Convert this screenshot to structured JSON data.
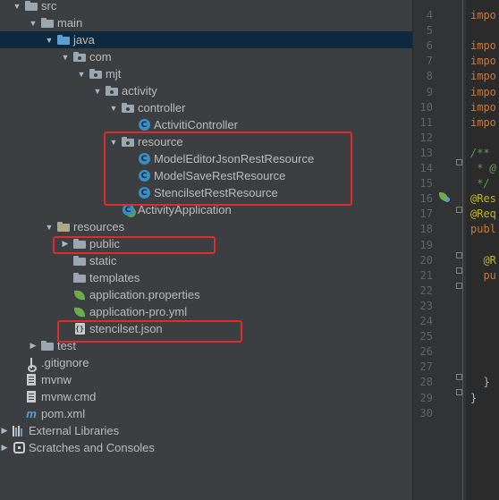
{
  "project_tree": {
    "items": [
      {
        "label": "src",
        "indent": 1,
        "arrow": "down",
        "icon": "folder-icon"
      },
      {
        "label": "main",
        "indent": 2,
        "arrow": "down",
        "icon": "folder-icon"
      },
      {
        "label": "java",
        "indent": 3,
        "arrow": "down",
        "icon": "source-folder-icon",
        "selected": true
      },
      {
        "label": "com",
        "indent": 4,
        "arrow": "down",
        "icon": "package-icon"
      },
      {
        "label": "mjt",
        "indent": 5,
        "arrow": "down",
        "icon": "package-icon"
      },
      {
        "label": "activity",
        "indent": 6,
        "arrow": "down",
        "icon": "package-icon"
      },
      {
        "label": "controller",
        "indent": 7,
        "arrow": "down",
        "icon": "package-icon"
      },
      {
        "label": "ActivitiController",
        "indent": 8,
        "arrow": "none",
        "icon": "class-icon"
      },
      {
        "label": "resource",
        "indent": 7,
        "arrow": "down",
        "icon": "package-icon"
      },
      {
        "label": "ModelEditorJsonRestResource",
        "indent": 8,
        "arrow": "none",
        "icon": "class-icon"
      },
      {
        "label": "ModelSaveRestResource",
        "indent": 8,
        "arrow": "none",
        "icon": "class-icon"
      },
      {
        "label": "StencilsetRestResource",
        "indent": 8,
        "arrow": "none",
        "icon": "class-icon"
      },
      {
        "label": "ActivityApplication",
        "indent": 7,
        "arrow": "none",
        "icon": "spring-class-icon"
      },
      {
        "label": "resources",
        "indent": 3,
        "arrow": "down",
        "icon": "resources-folder-icon"
      },
      {
        "label": "public",
        "indent": 4,
        "arrow": "right",
        "icon": "folder-icon"
      },
      {
        "label": "static",
        "indent": 4,
        "arrow": "none",
        "icon": "folder-icon"
      },
      {
        "label": "templates",
        "indent": 4,
        "arrow": "none",
        "icon": "folder-icon"
      },
      {
        "label": "application.properties",
        "indent": 4,
        "arrow": "none",
        "icon": "spring-leaf-icon"
      },
      {
        "label": "application-pro.yml",
        "indent": 4,
        "arrow": "none",
        "icon": "spring-leaf-icon"
      },
      {
        "label": "stencilset.json",
        "indent": 4,
        "arrow": "none",
        "icon": "json-file-icon"
      },
      {
        "label": "test",
        "indent": 2,
        "arrow": "right",
        "icon": "folder-icon"
      },
      {
        "label": ".gitignore",
        "indent": 1,
        "arrow": "none",
        "icon": "git-icon"
      },
      {
        "label": "mvnw",
        "indent": 1,
        "arrow": "none",
        "icon": "text-file-icon"
      },
      {
        "label": "mvnw.cmd",
        "indent": 1,
        "arrow": "none",
        "icon": "text-file-icon"
      },
      {
        "label": "pom.xml",
        "indent": 1,
        "arrow": "none",
        "icon": "maven-icon"
      },
      {
        "label": "External Libraries",
        "indent": 0,
        "arrow": "right",
        "icon": "libraries-icon"
      },
      {
        "label": "Scratches and Consoles",
        "indent": 0,
        "arrow": "right",
        "icon": "scratches-icon"
      }
    ]
  },
  "editor": {
    "line_numbers": [
      "4",
      "5",
      "6",
      "7",
      "8",
      "9",
      "10",
      "11",
      "12",
      "13",
      "14",
      "15",
      "16",
      "17",
      "18",
      "19",
      "20",
      "21",
      "22",
      "23",
      "24",
      "25",
      "26",
      "27",
      "28",
      "29",
      "30"
    ],
    "code_lines": [
      {
        "text": "impo",
        "style": "kw"
      },
      {
        "text": "",
        "style": ""
      },
      {
        "text": "impo",
        "style": "kw"
      },
      {
        "text": "impo",
        "style": "kw"
      },
      {
        "text": "impo",
        "style": "kw"
      },
      {
        "text": "impo",
        "style": "kw"
      },
      {
        "text": "impo",
        "style": "kw"
      },
      {
        "text": "impo",
        "style": "kw"
      },
      {
        "text": "",
        "style": ""
      },
      {
        "text": "/**",
        "style": "cmt"
      },
      {
        "text": " * @",
        "style": "cmt"
      },
      {
        "text": " */",
        "style": "cmt"
      },
      {
        "text": "@Res",
        "style": "ann"
      },
      {
        "text": "@Req",
        "style": "ann"
      },
      {
        "text": "publ",
        "style": "kw"
      },
      {
        "text": "",
        "style": ""
      },
      {
        "text": "  @R",
        "style": "ann"
      },
      {
        "text": "  pu",
        "style": "kw"
      },
      {
        "text": "",
        "style": ""
      },
      {
        "text": "",
        "style": ""
      },
      {
        "text": "",
        "style": ""
      },
      {
        "text": "",
        "style": ""
      },
      {
        "text": "",
        "style": ""
      },
      {
        "text": "",
        "style": ""
      },
      {
        "text": "  }",
        "style": ""
      },
      {
        "text": "}",
        "style": ""
      },
      {
        "text": "",
        "style": ""
      }
    ]
  },
  "colors": {
    "highlight_box": "#e02b2b",
    "selection": "#0d293e",
    "keyword": "#cc7832",
    "annotation": "#bbb529"
  }
}
